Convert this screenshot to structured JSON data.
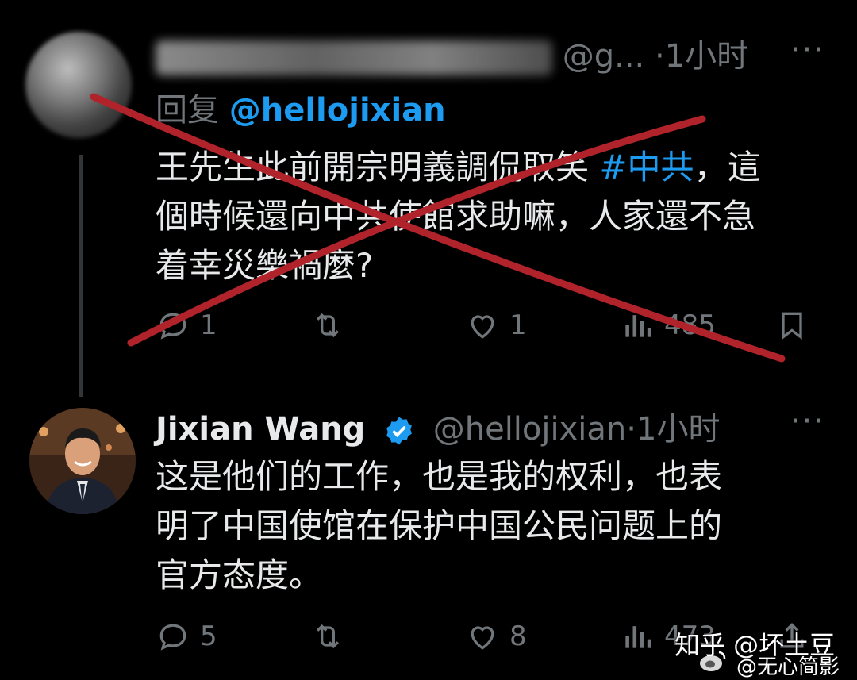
{
  "tweet1": {
    "handle_fragment": "@g...",
    "time": "1小时",
    "more_label": "···",
    "reply_prefix": "回复",
    "reply_mention": "@hellojixian",
    "text_line1_a": "王先生此前開宗明義調侃取笑 ",
    "hashtag": "#中共",
    "text_line1_b": "，這",
    "text_line2": "個時候還向中共使館求助嘛，人家還不急",
    "text_line3": "着幸災樂禍麼?",
    "reply_count": "1",
    "like_count": "1",
    "view_count": "485"
  },
  "tweet2": {
    "name": "Jixian Wang",
    "handle": "@hellojixian",
    "time": "·1小时",
    "more_label": "···",
    "text_line1": "这是他们的工作，也是我的权利，也表",
    "text_line2": "明了中国使馆在保护中国公民问题上的",
    "text_line3": "官方态度。",
    "reply_count": "5",
    "like_count": "8",
    "view_count": "473"
  },
  "watermark": {
    "line1": "知乎 @坏土豆",
    "line2": "@无心简影"
  },
  "colors": {
    "background": "#000000",
    "text": "#e7e9ea",
    "secondary": "#71767b",
    "accent": "#1d9bf0",
    "cross": "#b0232b"
  }
}
